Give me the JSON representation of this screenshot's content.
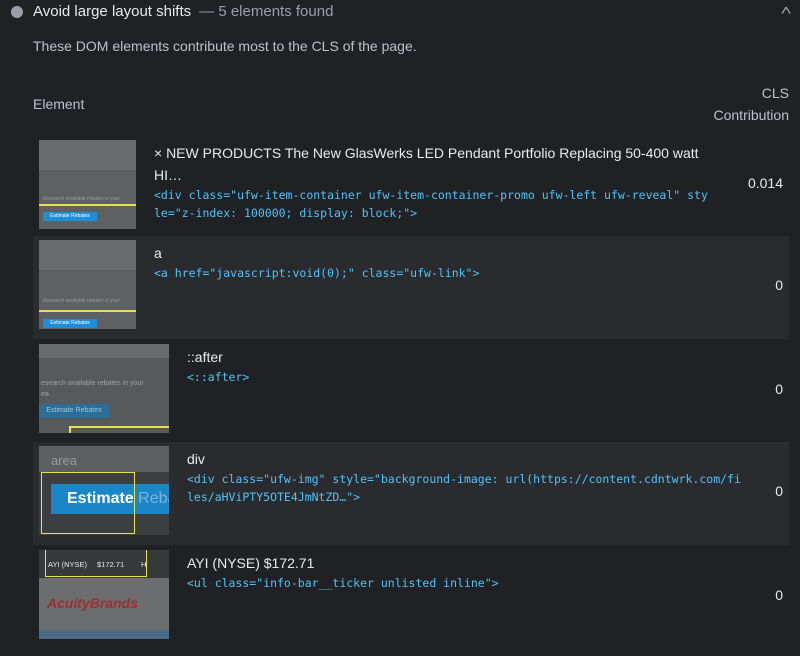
{
  "audit": {
    "title": "Avoid large layout shifts",
    "separator": "—",
    "count": "5 elements found",
    "description": "These DOM elements contribute most to the CLS of the page."
  },
  "table": {
    "col_element": "Element",
    "col_cls_line1": "CLS",
    "col_cls_line2": "Contribution",
    "rows": [
      {
        "label": "× NEW PRODUCTS The New GlasWerks LED Pendant Portfolio Replacing 50-400 watt HI…",
        "snippet": "<div class=\"ufw-item-container ufw-item-container-promo ufw-left ufw-reveal\" style=\"z-index: 100000; display: block;\">",
        "value": "0.014",
        "thumb": {
          "text": "Research available rebates in your",
          "button": "Estimate Rebates"
        }
      },
      {
        "label": "a",
        "snippet": "<a href=\"javascript:void(0);\" class=\"ufw-link\">",
        "value": "0",
        "thumb": {
          "text": "Research available rebates in your",
          "button": "Estimate Rebates"
        }
      },
      {
        "label": "::after",
        "snippet": "<::after>",
        "value": "0",
        "thumb": {
          "text": "esearch available rebates in your",
          "text2": "ea",
          "button": "Estimate Rebates"
        }
      },
      {
        "label": "div",
        "snippet": "<div class=\"ufw-img\" style=\"background-image: url(https://content.cdntwrk.com/files/aHViPTY5OTE4JmNtZD…\">",
        "value": "0",
        "thumb": {
          "text": "area",
          "button": "Estimate",
          "button_tail": "Reba"
        }
      },
      {
        "label": "AYI (NYSE) $172.71",
        "snippet": "<ul class=\"info-bar__ticker unlisted inline\">",
        "value": "0",
        "thumb": {
          "ticker": "AYI (NYSE)",
          "price": "$172.71",
          "tail": "H",
          "brand": "AcuityBrands"
        }
      }
    ]
  },
  "colors": {
    "background": "#202124",
    "stripe": "#2a2b2e",
    "snippet": "#4fc3f7",
    "highlight": "#e7e24a",
    "button": "#1e8fd6"
  },
  "icons": {
    "status": "gray-dot-icon",
    "collapse": "chevron-up-icon"
  }
}
